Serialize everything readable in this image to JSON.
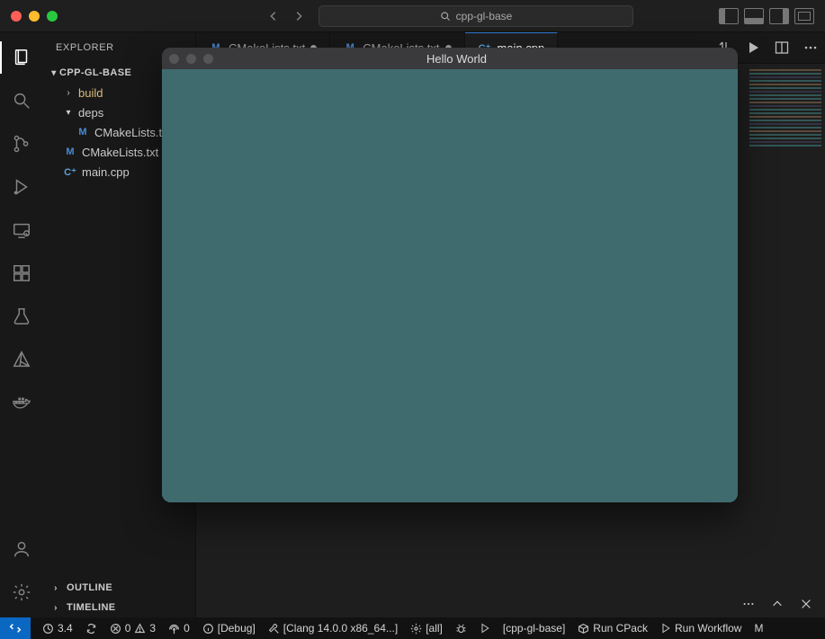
{
  "titlebar": {
    "search_text": "cpp-gl-base"
  },
  "sidebar": {
    "explorer_label": "EXPLORER",
    "project_name": "CPP-GL-BASE",
    "tree": {
      "build": "build",
      "deps": "deps",
      "cmakelists_deps": "CMakeLists.txt",
      "cmakelists_root": "CMakeLists.txt",
      "main_cpp": "main.cpp"
    },
    "outline": "OUTLINE",
    "timeline": "TIMELINE"
  },
  "tabs": {
    "tab1": "CMakeLists.txt",
    "tab2": "CMakeLists.txt",
    "tab3": "main.cpp"
  },
  "status": {
    "time": "3.4",
    "errors": "0",
    "warnings": "3",
    "ports": "0",
    "config": "[Debug]",
    "toolchain": "[Clang 14.0.0 x86_64...]",
    "target": "[all]",
    "runTarget": "[cpp-gl-base]",
    "cpack": "Run CPack",
    "workflow": "Run Workflow",
    "trailing": "M"
  },
  "overlay": {
    "title": "Hello World"
  }
}
